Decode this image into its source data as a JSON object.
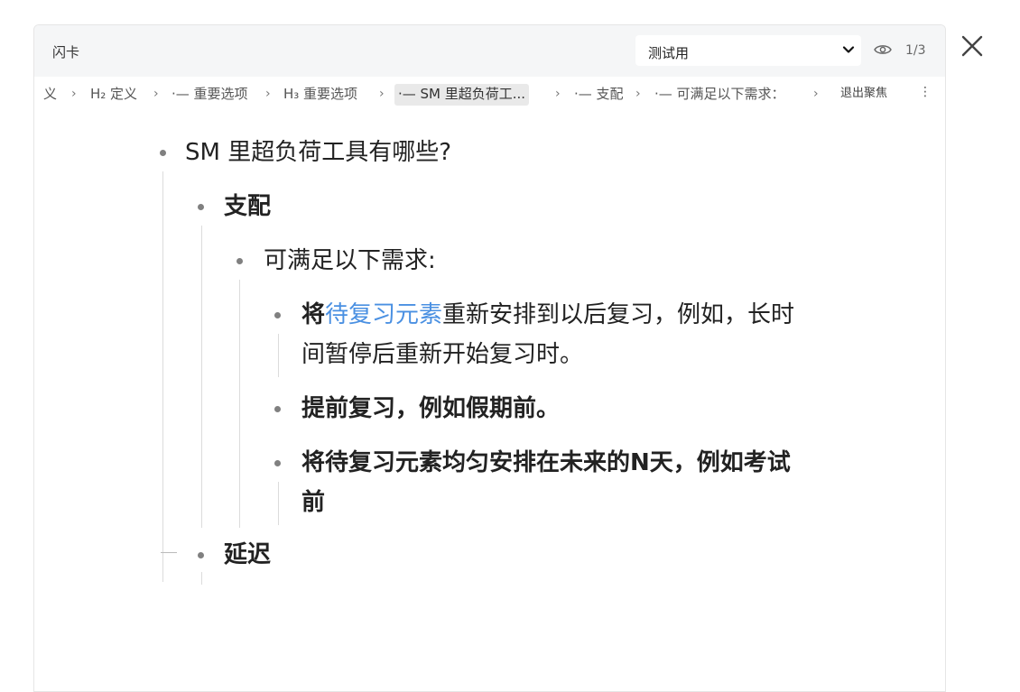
{
  "header": {
    "title": "闪卡",
    "deck_select_value": "测试用",
    "counter": "1/3"
  },
  "breadcrumb": {
    "items": [
      "义",
      "H₂ 定义",
      "·— 重要选项",
      "H₃ 重要选项",
      "·— SM 里超负荷工...",
      "·— 支配",
      "·— 可满足以下需求："
    ],
    "exit_label": "退出聚焦",
    "more_label": "⋮"
  },
  "outline": {
    "root": "SM 里超负荷工具有哪些?",
    "child1": "支配",
    "child1_1": "可满足以下需求:",
    "item1_bold": "将",
    "item1_link": "待复习元素",
    "item1_rest_line1": "重新安排到以后复习，例如，长时",
    "item1_rest_line2": "间暂停后重新开始复习时。",
    "item2": "提前复习，例如假期前。",
    "item3_line1": "将待复习元素均匀安排在未来的N天，例如考试",
    "item3_line2": "前",
    "child2": "延迟"
  },
  "colors": {
    "link": "#4a90e2",
    "topbar_bg": "#f5f6f7",
    "active_crumb_bg": "#e9e9e9"
  },
  "icons": [
    "chevron-down-icon",
    "eye-icon",
    "close-icon",
    "more-vertical-icon",
    "chevron-right-icon"
  ]
}
